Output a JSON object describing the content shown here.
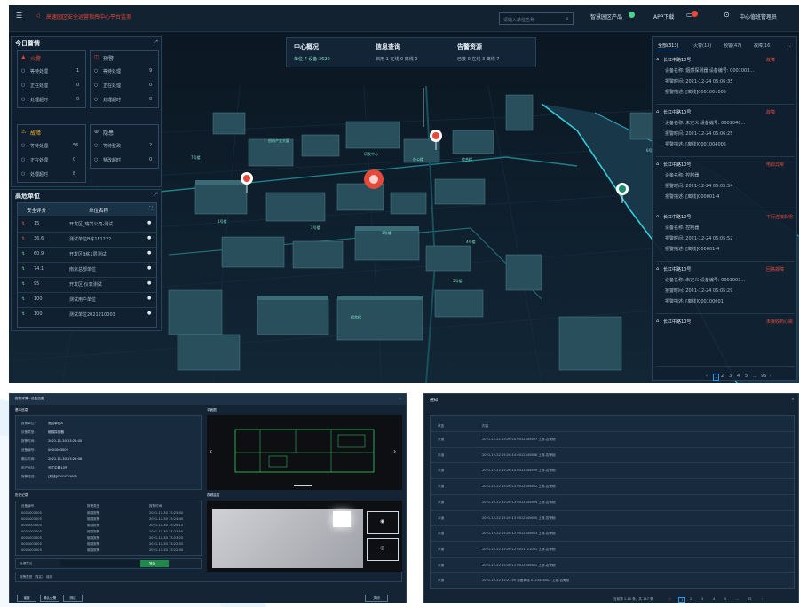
{
  "topbar": {
    "title": "高速园区安全运营指挥中心平台监测",
    "search_placeholder": "请输入单位名称",
    "btn_product": "智慧园区产品",
    "btn_app": "APP下载",
    "user": "中心值班管理员"
  },
  "today_alarm": {
    "title": "今日警情",
    "alarm": {
      "title": "火警",
      "rows": [
        {
          "label": "等待处理",
          "value": "1"
        },
        {
          "label": "正在处理",
          "value": "0"
        },
        {
          "label": "处理超时",
          "value": "0"
        }
      ]
    },
    "fire": {
      "title": "预警",
      "rows": [
        {
          "label": "等待处理",
          "value": "9"
        },
        {
          "label": "正在处理",
          "value": "0"
        },
        {
          "label": "处理超时",
          "value": "0"
        }
      ]
    },
    "fault": {
      "title": "故障",
      "rows": [
        {
          "label": "等待处理",
          "value": "56"
        },
        {
          "label": "正在处理",
          "value": "0"
        },
        {
          "label": "处理超时",
          "value": "8"
        }
      ]
    },
    "hidden": {
      "title": "隐患",
      "rows": [
        {
          "label": "等待整改",
          "value": "2"
        },
        {
          "label": "整改超时",
          "value": "0"
        }
      ]
    }
  },
  "safety": {
    "title": "高危单位",
    "col_score": "安全评分",
    "col_name": "单位名称",
    "rows": [
      {
        "score": "15",
        "name": "开发区_瑞发公司-测试"
      },
      {
        "score": "36.6",
        "name": "测试单位B栋1F1222"
      },
      {
        "score": "60.9",
        "name": "开发区B栋1层测试"
      },
      {
        "score": "74.1",
        "name": "南京总部单位"
      },
      {
        "score": "95",
        "name": "开发区-仪表测试"
      },
      {
        "score": "100",
        "name": "测试用户单位"
      },
      {
        "score": "100",
        "name": "测试单位2021210003"
      }
    ]
  },
  "stats": {
    "center": {
      "title": "中心概况",
      "line": "单位 7   设备 3620"
    },
    "info": {
      "title": "信息查询",
      "line": "启用 1   在线 0   离线 0"
    },
    "alarm": {
      "title": "告警资源",
      "line": "已接 0   在线 3   离线 7"
    }
  },
  "right_panel": {
    "tabs": [
      "全部(313)",
      "火警(13)",
      "预警(47)",
      "故障(16)"
    ],
    "items": [
      {
        "title": "长江中路10号",
        "status": "故障",
        "line1": "设备名称: 烟感探测器    设备编号: 0001003...",
        "line2": "报警时间: 2021-12-24 05:06:35",
        "line3": "报警描述: [离线]0001001005"
      },
      {
        "title": "长江中路10号",
        "status": "故障",
        "line1": "设备名称: 未定义    设备编号: 0001040...",
        "line2": "报警时间: 2021-12-24 05:06:25",
        "line3": "报警描述: [离线]0001004005"
      },
      {
        "title": "长江中路10号",
        "status": "电源异常",
        "line1": "设备名称: 控制器",
        "line2": "报警时间: 2021-12-24 05:05:54",
        "line3": "报警描述: [离线]000001-4"
      },
      {
        "title": "长江中路10号",
        "status": "下行连接异常",
        "line1": "设备名称: 控制器",
        "line2": "报警时间: 2021-12-24 05:05:52",
        "line3": "报警描述: [离线]000001-4"
      },
      {
        "title": "长江中路10号",
        "status": "回路故障",
        "line1": "设备名称: 未定义    设备编号: 0001003...",
        "line2": "报警时间: 2021-12-24 05:05:29",
        "line3": "报警描述: [离线]000100001"
      },
      {
        "title": "长江中路10号",
        "status": "未接收到心跳",
        "line1": "",
        "line2": "",
        "line3": ""
      }
    ],
    "pages": [
      "1",
      "2",
      "3",
      "4",
      "5",
      "...",
      "96"
    ]
  },
  "map_labels": [
    "创新产业大厦",
    "研发中心",
    "1号楼",
    "2号楼",
    "3号楼",
    "4号楼",
    "5号楼",
    "6号楼",
    "7号楼",
    "办公楼",
    "综合楼",
    "宿舍楼"
  ],
  "dialog1": {
    "title": "报警详情 - 设备信息",
    "section_info": "基本信息",
    "section_map": "平面图",
    "fields": [
      {
        "k": "报警单位:",
        "v": "测试单位A"
      },
      {
        "k": "设备类型:",
        "v": "烟感探测器"
      },
      {
        "k": "报警时间:",
        "v": "2021-11-30 15:25:00"
      },
      {
        "k": "设备编号:",
        "v": "0001003005"
      },
      {
        "k": "确认时间:",
        "v": "2021-11-30 15:25:06"
      },
      {
        "k": "用户地址:",
        "v": "长江中路10号"
      },
      {
        "k": "报警描述:",
        "v": "[离线]0001003005"
      }
    ],
    "section_log": "历史记录",
    "section_video": "视频监控",
    "log_header": [
      "设备编号",
      "报警类型",
      "报警时间"
    ],
    "log_rows": [
      {
        "a": "0001003005",
        "b": "烟感报警",
        "c": "2021-11-30 15:25:00"
      },
      {
        "a": "0001003005",
        "b": "烟感报警",
        "c": "2021-11-30 15:24:40"
      },
      {
        "a": "0001003005",
        "b": "烟感报警",
        "c": "2021-11-30 15:24:10"
      },
      {
        "a": "0001003005",
        "b": "烟感报警",
        "c": "2021-11-30 15:23:50"
      },
      {
        "a": "0001003005",
        "b": "烟感报警",
        "c": "2021-11-30 15:23:20"
      },
      {
        "a": "0001003005",
        "b": "烟感报警",
        "c": "2021-11-30 15:22:55"
      },
      {
        "a": "0001003005",
        "b": "烟感报警",
        "c": "2021-11-30 15:22:30"
      }
    ],
    "input_label": "处理意见",
    "submit": "提交",
    "note": "报警类型（真实）  误报",
    "btns": [
      "误报",
      "确认火警",
      "测试"
    ],
    "close": "关闭"
  },
  "dialog2": {
    "title": "通知",
    "header": [
      "状态",
      "内容"
    ],
    "rows": [
      {
        "status": "未读",
        "content": "2021-12-22 15:26:14  0012345607  上报-告警帧"
      },
      {
        "status": "未读",
        "content": "2021-12-22 15:26:14  0012345608  上报-告警帧"
      },
      {
        "status": "未读",
        "content": "2021-12-22 15:26:14  0012345609  上报-告警帧"
      },
      {
        "status": "未读",
        "content": "2021-12-22 15:26:13  0012345602  上报-告警帧"
      },
      {
        "status": "未读",
        "content": "2021-12-22 15:26:13  0012345604  上报-告警帧"
      },
      {
        "status": "未读",
        "content": "2021-12-22 15:26:13  0012345605  上报-告警帧"
      },
      {
        "status": "未读",
        "content": "2021-12-22 15:26:12  0012345603  上报-告警帧"
      },
      {
        "status": "未读",
        "content": "2021-12-22 15:26:12  0011111001  上报-告警帧"
      },
      {
        "status": "未读",
        "content": "2021-12-22 15:26:11  0012345601  上报-告警帧"
      },
      {
        "status": "未读",
        "content": "2021-12-22 15:21:05  设备离线 0123456002  上报-告警帧"
      }
    ],
    "footer": "当前第 1-10 条，共 147 条",
    "pages": [
      "1",
      "2",
      "3",
      "4",
      "5",
      "...",
      "15"
    ]
  },
  "colors": {
    "bg": "#0d1b28",
    "accent": "#1e9bff",
    "alarm": "#e5493a",
    "ok": "#4fd18b"
  }
}
